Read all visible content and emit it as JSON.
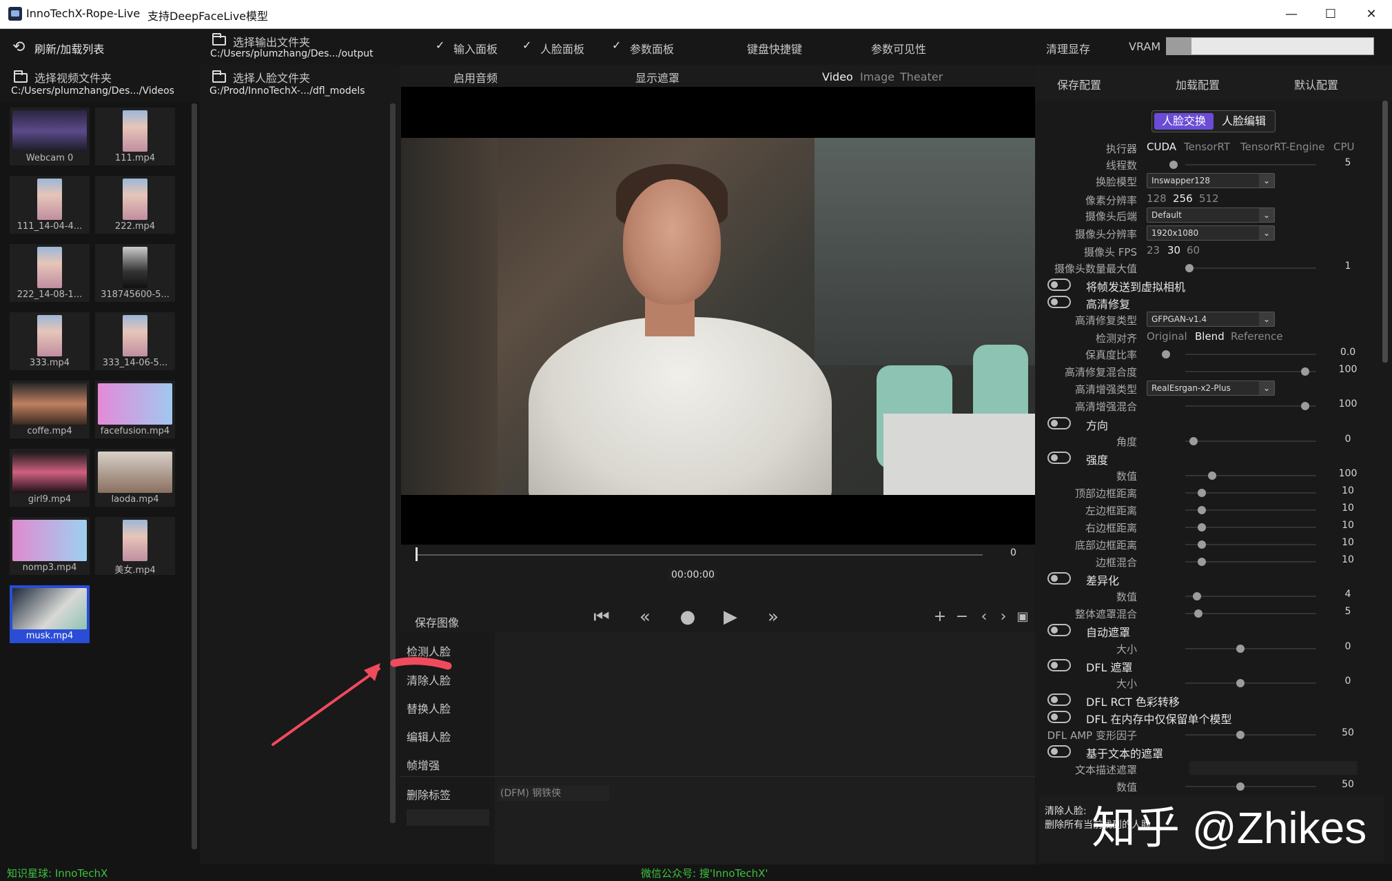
{
  "window": {
    "title": "InnoTechX-Rope-Live",
    "subtitle": "支持DeepFaceLive模型",
    "minimize": "—",
    "maximize": "☐",
    "close": "✕"
  },
  "topbar": {
    "refresh_label": "刷新/加载列表",
    "output_label": "选择输出文件夹",
    "output_path": "C:/Users/plumzhang/Des.../output",
    "input_panel": "输入面板",
    "face_panel": "人脸面板",
    "param_panel": "参数面板",
    "shortcuts": "键盘快捷键",
    "param_visibility": "参数可见性",
    "clear_vram": "清理显存",
    "vram_label": "VRAM",
    "vram_fraction": 0.12
  },
  "left": {
    "video_folder_label": "选择视频文件夹",
    "video_folder_path": "C:/Users/plumzhang/Des.../Videos",
    "face_folder_label": "选择人脸文件夹",
    "face_folder_path": "G:/Prod/InnoTechX-.../dfl_models",
    "thumbnails": [
      {
        "label": "Webcam 0"
      },
      {
        "label": "111.mp4"
      },
      {
        "label": "111_14-04-4..."
      },
      {
        "label": "222.mp4"
      },
      {
        "label": "222_14-08-1..."
      },
      {
        "label": "318745600-5..."
      },
      {
        "label": "333.mp4"
      },
      {
        "label": "333_14-06-5..."
      },
      {
        "label": "coffe.mp4"
      },
      {
        "label": "facefusion.mp4"
      },
      {
        "label": "girl9.mp4"
      },
      {
        "label": "laoda.mp4"
      },
      {
        "label": "nomp3.mp4"
      },
      {
        "label": "美女.mp4"
      },
      {
        "label": "musk.mp4"
      }
    ]
  },
  "center": {
    "enable_audio": "启用音频",
    "show_mask": "显示遮罩",
    "mode_video": "Video",
    "mode_image": "Image",
    "mode_theater": "Theater",
    "frame_number": "0",
    "timecode": "00:00:00",
    "save_image": "保存图像",
    "actions": [
      "检测人脸",
      "清除人脸",
      "替换人脸",
      "编辑人脸",
      "帧增强",
      "删除标签"
    ],
    "model_item": "(DFM) 钢铁侠"
  },
  "right": {
    "save_config": "保存配置",
    "load_config": "加载配置",
    "default_config": "默认配置",
    "tab_swap": "人脸交换",
    "tab_edit": "人脸编辑",
    "executor_label": "执行器",
    "executor_options": [
      "CUDA",
      "TensorRT",
      "TensorRT-Engine",
      "CPU"
    ],
    "threads_label": "线程数",
    "threads_value": "5",
    "swap_model_label": "换脸模型",
    "swap_model_value": "Inswapper128",
    "pixel_res_label": "像素分辨率",
    "pixel_res_options": [
      "128",
      "256",
      "512"
    ],
    "cam_backend_label": "摄像头后端",
    "cam_backend_value": "Default",
    "cam_res_label": "摄像头分辨率",
    "cam_res_value": "1920x1080",
    "cam_fps_label": "摄像头 FPS",
    "cam_fps_options": [
      "23",
      "30",
      "60"
    ],
    "cam_max_label": "摄像头数量最大值",
    "cam_max_value": "1",
    "virtual_cam": "将帧发送到虚拟相机",
    "hd_restore": "高清修复",
    "hd_type_label": "高清修复类型",
    "hd_type_value": "GFPGAN-v1.4",
    "align_label": "检测对齐",
    "align_options": [
      "Original",
      "Blend",
      "Reference"
    ],
    "fidelity_label": "保真度比率",
    "fidelity_value": "0.0",
    "hd_blend_label": "高清修复混合度",
    "hd_blend_value": "100",
    "enhance_type_label": "高清增强类型",
    "enhance_type_value": "RealEsrgan-x2-Plus",
    "enhance_blend_label": "高清增强混合",
    "enhance_blend_value": "100",
    "orientation": "方向",
    "angle_label": "角度",
    "angle_value": "0",
    "strength": "强度",
    "strength_val_label": "数值",
    "strength_val_value": "100",
    "top_border_label": "顶部边框距离",
    "top_border_value": "10",
    "left_border_label": "左边框距离",
    "left_border_value": "10",
    "right_border_label": "右边框距离",
    "right_border_value": "10",
    "bottom_border_label": "底部边框距离",
    "bottom_border_value": "10",
    "border_blend_label": "边框混合",
    "border_blend_value": "10",
    "diff": "差异化",
    "diff_val_label": "数值",
    "diff_val_value": "4",
    "overall_mask_label": "整体遮罩混合",
    "overall_mask_value": "5",
    "auto_mask": "自动遮罩",
    "auto_size_label": "大小",
    "auto_size_value": "0",
    "dfl_mask": "DFL 遮罩",
    "dfl_size_label": "大小",
    "dfl_size_value": "0",
    "dfl_rct": "DFL RCT 色彩转移",
    "dfl_single": "DFL 在内存中仅保留单个模型",
    "dfl_amp_label": "DFL AMP 变形因子",
    "dfl_amp_value": "50",
    "text_mask": "基于文本的遮罩",
    "text_desc_label": "文本描述遮罩",
    "text_val_label": "数值",
    "text_val_value": "50",
    "tooltip_title": "清除人脸:",
    "tooltip_body": "删除所有当前找到的人脸"
  },
  "status": {
    "left": "知识星球: InnoTechX",
    "center": "微信公众号: 搜'InnoTechX'"
  },
  "watermark": "知乎 @Zhikes"
}
